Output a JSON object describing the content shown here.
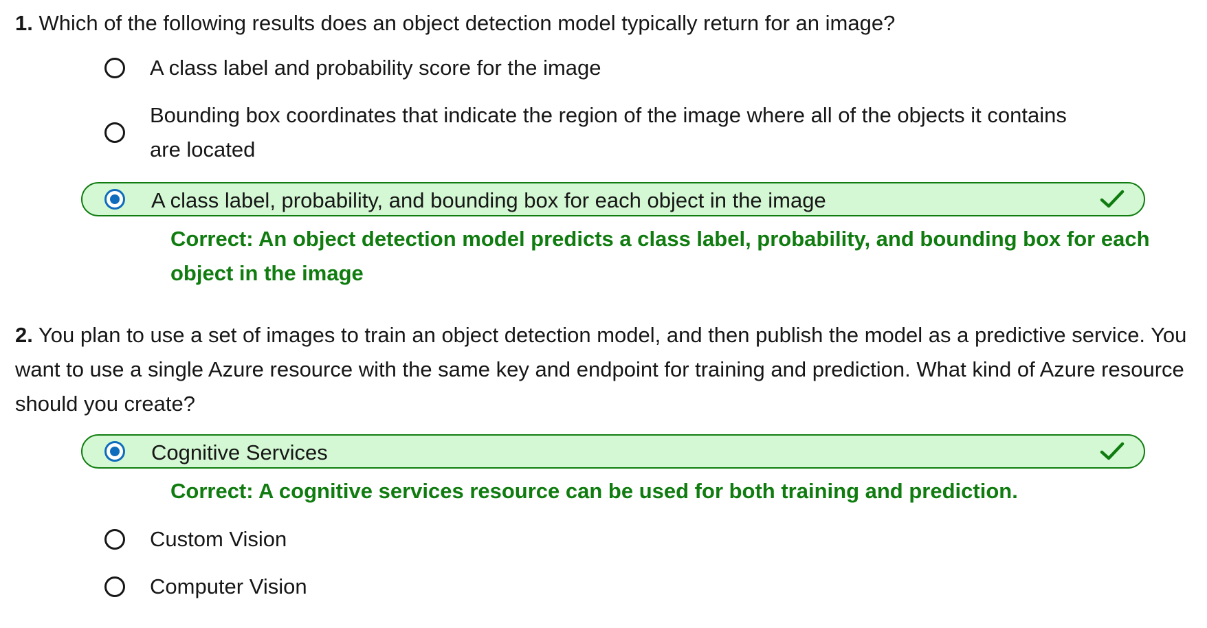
{
  "questions": [
    {
      "number": "1.",
      "text": "Which of the following results does an object detection model typically return for an image?",
      "options": [
        {
          "label": "A class label and probability score for the image",
          "selected": false
        },
        {
          "label": "Bounding box coordinates that indicate the region of the image where all of the objects it contains are located",
          "selected": false
        },
        {
          "label": "A class label, probability, and bounding box for each object in the image",
          "selected": true,
          "correct": true
        }
      ],
      "feedback": "Correct: An object detection model predicts a class label, probability, and bounding box for each object in the image"
    },
    {
      "number": "2.",
      "text": "You plan to use a set of images to train an object detection model, and then publish the model as a predictive service. You want to use a single Azure resource with the same key and endpoint for training and prediction. What kind of Azure resource should you create?",
      "options": [
        {
          "label": "Cognitive Services",
          "selected": true,
          "correct": true
        },
        {
          "label": "Custom Vision",
          "selected": false
        },
        {
          "label": "Computer Vision",
          "selected": false
        }
      ],
      "feedback": "Correct: A cognitive services resource can be used for both training and prediction."
    }
  ],
  "colors": {
    "correct_green": "#107c10",
    "correct_bg": "#d3f8d3",
    "radio_selected": "#0f6cbd",
    "text": "#161616"
  },
  "icons": {
    "check": "checkmark-icon",
    "radio_empty": "radio-unselected",
    "radio_filled": "radio-selected"
  }
}
